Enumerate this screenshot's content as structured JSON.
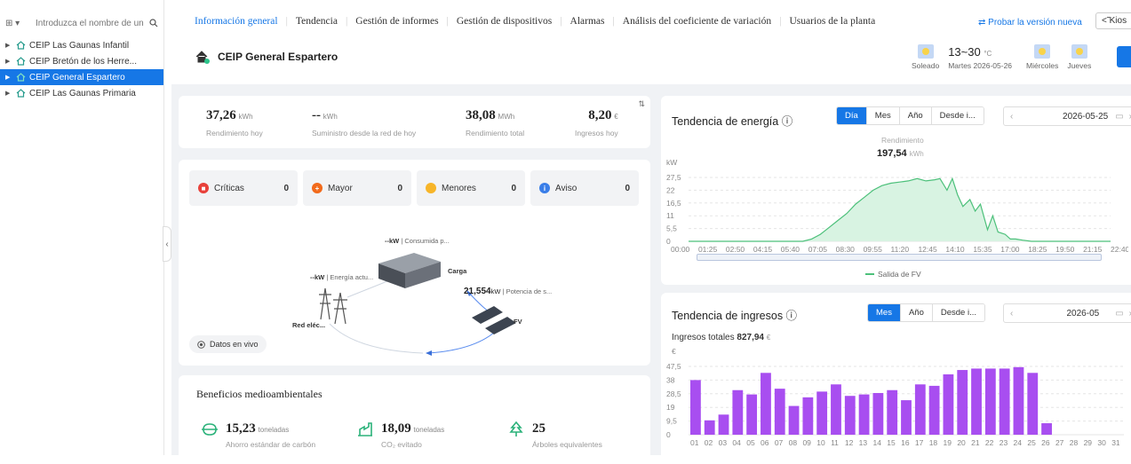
{
  "sidebar": {
    "selector_label": "⊞ ▾",
    "search_placeholder": "Introduzca el nombre de un d",
    "plants": [
      {
        "label": "CEIP Las Gaunas Infantil"
      },
      {
        "label": "CEIP Bretón de los Herre..."
      },
      {
        "label": "CEIP General Espartero"
      },
      {
        "label": "CEIP Las Gaunas Primaria"
      }
    ]
  },
  "tabs": [
    {
      "label": "Información general"
    },
    {
      "label": "Tendencia"
    },
    {
      "label": "Gestión de informes"
    },
    {
      "label": "Gestión de dispositivos"
    },
    {
      "label": "Alarmas"
    },
    {
      "label": "Análisis del coeficiente de variación"
    },
    {
      "label": "Usuarios de la planta"
    }
  ],
  "header": {
    "try_new": "⇄ Probar la versión nueva",
    "kiosk": "<̃ Kios",
    "plant_name": "CEIP General Espartero"
  },
  "weather": {
    "temp": "13~30",
    "temp_unit": "°C",
    "today_label": "Soleado",
    "today_date": "Martes 2026-05-26",
    "day2": "Miércoles",
    "day3": "Jueves"
  },
  "kpis": [
    {
      "value": "37,26",
      "unit": "kWh",
      "label": "Rendimiento hoy"
    },
    {
      "value": "--",
      "unit": "kWh",
      "label": "Suministro desde la red de hoy"
    },
    {
      "value": "38,08",
      "unit": "MWh",
      "label": "Rendimiento total"
    },
    {
      "value": "8,20",
      "unit": "€",
      "label": "Ingresos hoy"
    }
  ],
  "alarms": [
    {
      "label": "Críticas",
      "count": "0",
      "color": "#e8403a"
    },
    {
      "label": "Mayor",
      "count": "0",
      "color": "#f26a1b"
    },
    {
      "label": "Menores",
      "count": "0",
      "color": "#f7b529"
    },
    {
      "label": "Aviso",
      "count": "0",
      "color": "#3a7ee8"
    }
  ],
  "flow": {
    "consumed": "--kW",
    "consumed_label": "Consumida p...",
    "load_label": "Carga",
    "grid_power": "--kW",
    "grid_power_label": "Energía actu...",
    "pv_power": "21,554",
    "pv_unit": "kW",
    "pv_power_label": "Potencia de s...",
    "pv_label": "FV",
    "grid_label": "Red eléc...",
    "live_label": "Datos en vivo"
  },
  "environment": {
    "title": "Beneficios medioambientales",
    "items": [
      {
        "value": "15,23",
        "unit": "toneladas",
        "label": "Ahorro estándar de carbón"
      },
      {
        "value": "18,09",
        "unit": "toneladas",
        "label": "CO₂ evitado"
      },
      {
        "value": "25",
        "unit": "",
        "label": "Árboles equivalentes"
      }
    ]
  },
  "energy_trend": {
    "title": "Tendencia de energía ⓘ",
    "buttons": [
      "Día",
      "Mes",
      "Año",
      "Desde i..."
    ],
    "date": "2026-05-25",
    "summary_label": "Rendimiento",
    "summary_value": "197,54",
    "summary_unit": "kWh",
    "legend": "Salida de FV"
  },
  "income_trend": {
    "title": "Tendencia de ingresos ⓘ",
    "buttons": [
      "Mes",
      "Año",
      "Desde i..."
    ],
    "date": "2026-05",
    "total_label": "Ingresos totales",
    "total_value": "827,94",
    "total_unit": "€"
  },
  "chart_data": [
    {
      "type": "area",
      "ylabel": "kW",
      "ylim": [
        0,
        27.5
      ],
      "yticks": [
        "27,5",
        "22",
        "16,5",
        "11",
        "5,5",
        "0"
      ],
      "xticks": [
        "00:00",
        "01:25",
        "02:50",
        "04:15",
        "05:40",
        "07:05",
        "08:30",
        "09:55",
        "11:20",
        "12:45",
        "14:10",
        "15:35",
        "17:00",
        "18:25",
        "19:50",
        "21:15",
        "22:40"
      ],
      "x_hours": [
        0,
        6.5,
        7,
        7.5,
        8,
        8.5,
        9,
        9.5,
        10,
        10.5,
        11,
        11.5,
        12,
        12.5,
        13,
        13.5,
        14,
        14.3,
        14.7,
        15,
        15.3,
        15.6,
        16,
        16.3,
        16.6,
        17,
        17.3,
        17.6,
        18,
        18.3,
        18.6,
        19,
        19.5,
        20,
        24
      ],
      "values": [
        0,
        0,
        1,
        3,
        6,
        9,
        12,
        16,
        19,
        22,
        24,
        25,
        25.5,
        26,
        27,
        26,
        26.5,
        27,
        22,
        27,
        20,
        15,
        18,
        13,
        16,
        5,
        11,
        4,
        3,
        1,
        1,
        0.5,
        0,
        0,
        0
      ],
      "series": [
        {
          "name": "Salida de FV",
          "color": "#4cc07a"
        }
      ]
    },
    {
      "type": "bar",
      "ylabel": "€",
      "ylim": [
        0,
        47.5
      ],
      "yticks": [
        "47,5",
        "38",
        "28,5",
        "19",
        "9,5",
        "0"
      ],
      "categories": [
        "01",
        "02",
        "03",
        "04",
        "05",
        "06",
        "07",
        "08",
        "09",
        "10",
        "11",
        "12",
        "13",
        "14",
        "15",
        "16",
        "17",
        "18",
        "19",
        "20",
        "21",
        "22",
        "23",
        "24",
        "25",
        "26",
        "27",
        "28",
        "29",
        "30",
        "31"
      ],
      "values": [
        38,
        10,
        14,
        31,
        28,
        43,
        32,
        20,
        26,
        30,
        35,
        27,
        28,
        29,
        31,
        24,
        35,
        34,
        42,
        45,
        46,
        46,
        46,
        47,
        43,
        8,
        0,
        0,
        0,
        0,
        0
      ],
      "series": [
        {
          "name": "Ingresos",
          "color": "#a84ef0"
        }
      ]
    }
  ]
}
